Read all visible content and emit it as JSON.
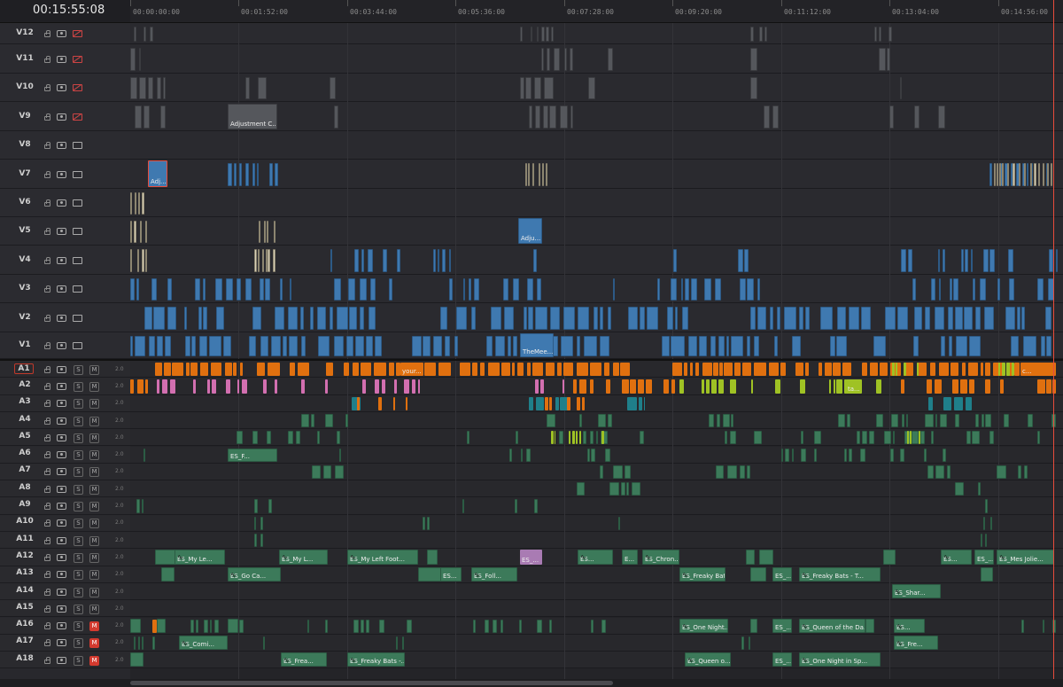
{
  "timecode": "00:15:55:08",
  "ruler": [
    "00:00:00:00",
    "00:01:52:00",
    "00:03:44:00",
    "00:05:36:00",
    "00:07:28:00",
    "00:09:20:00",
    "00:11:12:00",
    "00:13:04:00",
    "00:14:56:00"
  ],
  "video_tracks": [
    {
      "name": "V12",
      "monitor": "off"
    },
    {
      "name": "V11",
      "monitor": "off"
    },
    {
      "name": "V10",
      "monitor": "off"
    },
    {
      "name": "V9",
      "monitor": "off"
    },
    {
      "name": "V8",
      "monitor": "on"
    },
    {
      "name": "V7",
      "monitor": "on"
    },
    {
      "name": "V6",
      "monitor": "on"
    },
    {
      "name": "V5",
      "monitor": "on"
    },
    {
      "name": "V4",
      "monitor": "on"
    },
    {
      "name": "V3",
      "monitor": "on"
    },
    {
      "name": "V2",
      "monitor": "on"
    },
    {
      "name": "V1",
      "monitor": "on"
    }
  ],
  "audio_tracks": [
    {
      "name": "A1",
      "mute": false,
      "vol": "2.0"
    },
    {
      "name": "A2",
      "mute": false,
      "vol": "2.0"
    },
    {
      "name": "A3",
      "mute": false,
      "vol": "2.0"
    },
    {
      "name": "A4",
      "mute": false,
      "vol": "2.0"
    },
    {
      "name": "A5",
      "mute": false,
      "vol": "2.0"
    },
    {
      "name": "A6",
      "mute": false,
      "vol": "2.0"
    },
    {
      "name": "A7",
      "mute": false,
      "vol": "2.0"
    },
    {
      "name": "A8",
      "mute": false,
      "vol": "2.0"
    },
    {
      "name": "A9",
      "mute": false,
      "vol": "2.0"
    },
    {
      "name": "A10",
      "mute": false,
      "vol": "2.0"
    },
    {
      "name": "A11",
      "mute": false,
      "vol": "2.0"
    },
    {
      "name": "A12",
      "mute": false,
      "vol": "2.0"
    },
    {
      "name": "A13",
      "mute": false,
      "vol": "2.0"
    },
    {
      "name": "A14",
      "mute": false,
      "vol": "2.0"
    },
    {
      "name": "A15",
      "mute": false,
      "vol": "2.0"
    },
    {
      "name": "A16",
      "mute": true,
      "vol": "2.0"
    },
    {
      "name": "A17",
      "mute": true,
      "vol": "2.0"
    },
    {
      "name": "A18",
      "mute": true,
      "vol": "2.0"
    }
  ],
  "clip_labels": {
    "v9_adjust": "Adjustment C...",
    "v7_adj": "Adj...",
    "v5_adju": "Adju...",
    "v1_themee": "TheMee...",
    "a1_your": "your...",
    "a1_c": "c...",
    "a2_ta": "ta...",
    "a6_esf": "ES_F...",
    "a12_1": "ES_My Le...",
    "a12_2": "ES_My L...",
    "a12_3": "ES_My Left Foot...",
    "a12_4": "ES_...",
    "a12_5": "ES...",
    "a12_6": "E...",
    "a12_7": "ES_Chron...",
    "a12_8": "ES...",
    "a12_9": "ES_...",
    "a12_10": "ES_Mes Jolie...",
    "a13_1": "ES_Go Ca...",
    "a13_2": "ES...",
    "a13_3": "ES_Foll...",
    "a13_4": "ES_Freaky Bat...",
    "a13_5": "ES_...",
    "a13_6": "ES_Freaky Bats - T...",
    "a14_1": "ES_Shar...",
    "a16_1": "ES_One Night...",
    "a16_2": "ES_...",
    "a16_3": "ES_Queen of the Da...",
    "a16_4": "ES...",
    "a17_1": "ES_Comi...",
    "a17_2": "ES_Fre...",
    "a18_1": "ES_Frea...",
    "a18_2": "ES_Freaky Bats -...",
    "a18_3": "ES_Queen o...",
    "a18_4": "ES_...",
    "a18_5": "ES_One Night in Sp..."
  }
}
